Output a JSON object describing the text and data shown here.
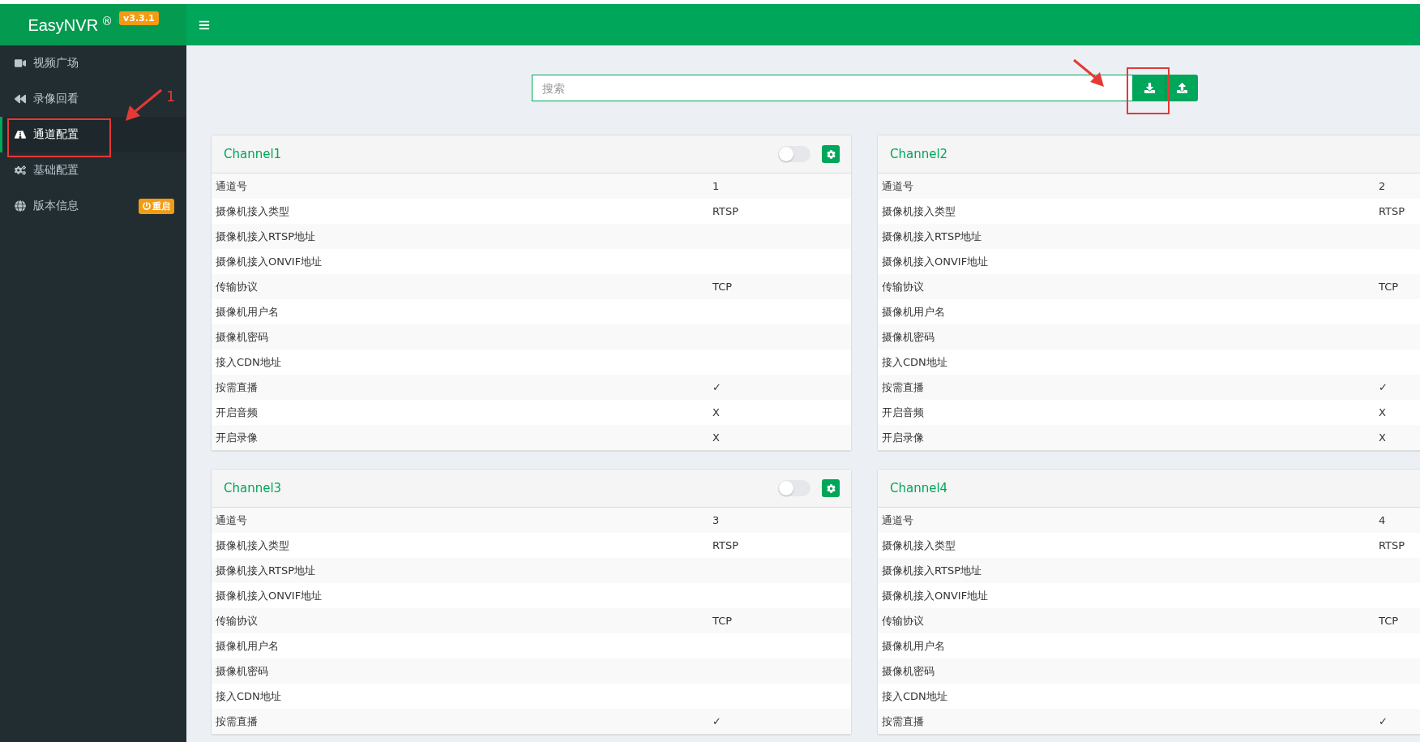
{
  "brand": {
    "name": "EasyNVR",
    "mark": "®",
    "version": "v3.3.1"
  },
  "sidebar": {
    "items": [
      {
        "label": "视频广场",
        "selected": false
      },
      {
        "label": "录像回看",
        "selected": false
      },
      {
        "label": "通道配置",
        "selected": true
      },
      {
        "label": "基础配置",
        "selected": false
      },
      {
        "label": "版本信息",
        "selected": false,
        "badge": "重启"
      }
    ]
  },
  "search": {
    "placeholder": "搜索"
  },
  "toolbar_buttons": [
    {
      "kind": "download"
    },
    {
      "kind": "upload"
    }
  ],
  "channels": [
    {
      "title": "Channel1",
      "enabled": false,
      "rows": [
        {
          "label": "通道号",
          "value": "1"
        },
        {
          "label": "摄像机接入类型",
          "value": "RTSP"
        },
        {
          "label": "摄像机接入RTSP地址"
        },
        {
          "label": "摄像机接入ONVIF地址"
        },
        {
          "label": "传输协议",
          "value": "TCP"
        },
        {
          "label": "摄像机用户名"
        },
        {
          "label": "摄像机密码"
        },
        {
          "label": "接入CDN地址"
        },
        {
          "label": "按需直播",
          "value": "✓"
        },
        {
          "label": "开启音频",
          "value": "X"
        },
        {
          "label": "开启录像",
          "value": "X"
        }
      ]
    },
    {
      "title": "Channel2",
      "rows": [
        {
          "label": "通道号",
          "value": "2"
        },
        {
          "label": "摄像机接入类型",
          "value": "RTSP"
        },
        {
          "label": "摄像机接入RTSP地址"
        },
        {
          "label": "摄像机接入ONVIF地址"
        },
        {
          "label": "传输协议",
          "value": "TCP"
        },
        {
          "label": "摄像机用户名"
        },
        {
          "label": "摄像机密码"
        },
        {
          "label": "接入CDN地址"
        },
        {
          "label": "按需直播",
          "value": "✓"
        },
        {
          "label": "开启音频",
          "value": "X"
        },
        {
          "label": "开启录像",
          "value": "X"
        }
      ]
    },
    {
      "title": "Channel3",
      "enabled": false,
      "rows": [
        {
          "label": "通道号",
          "value": "3"
        },
        {
          "label": "摄像机接入类型",
          "value": "RTSP"
        },
        {
          "label": "摄像机接入RTSP地址"
        },
        {
          "label": "摄像机接入ONVIF地址"
        },
        {
          "label": "传输协议",
          "value": "TCP"
        },
        {
          "label": "摄像机用户名"
        },
        {
          "label": "摄像机密码"
        },
        {
          "label": "接入CDN地址"
        },
        {
          "label": "按需直播",
          "value": "✓"
        }
      ]
    },
    {
      "title": "Channel4",
      "rows": [
        {
          "label": "通道号",
          "value": "4"
        },
        {
          "label": "摄像机接入类型",
          "value": "RTSP"
        },
        {
          "label": "摄像机接入RTSP地址"
        },
        {
          "label": "摄像机接入ONVIF地址"
        },
        {
          "label": "传输协议",
          "value": "TCP"
        },
        {
          "label": "摄像机用户名"
        },
        {
          "label": "摄像机密码"
        },
        {
          "label": "接入CDN地址"
        },
        {
          "label": "按需直播",
          "value": "✓"
        }
      ]
    }
  ],
  "annotation": {
    "label": "1"
  }
}
